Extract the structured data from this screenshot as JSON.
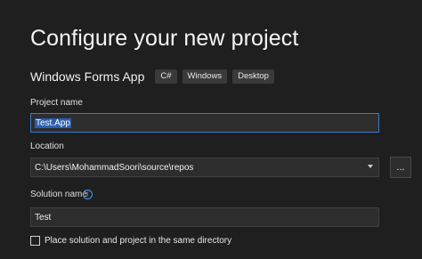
{
  "header": {
    "title": "Configure your new project"
  },
  "template": {
    "name": "Windows Forms App",
    "tags": [
      "C#",
      "Windows",
      "Desktop"
    ]
  },
  "project_name": {
    "label": "Project name",
    "value": "Test.App"
  },
  "location": {
    "label": "Location",
    "value": "C:\\Users\\MohammadSoori\\source\\repos",
    "browse_label": "..."
  },
  "solution_name": {
    "label": "Solution name",
    "value": "Test",
    "info_icon": "info-icon"
  },
  "same_directory": {
    "label": "Place solution and project in the same directory",
    "checked": false
  },
  "colors": {
    "background": "#1f1f1f",
    "accent": "#3b7bc8",
    "selection": "#2a5fb0"
  }
}
